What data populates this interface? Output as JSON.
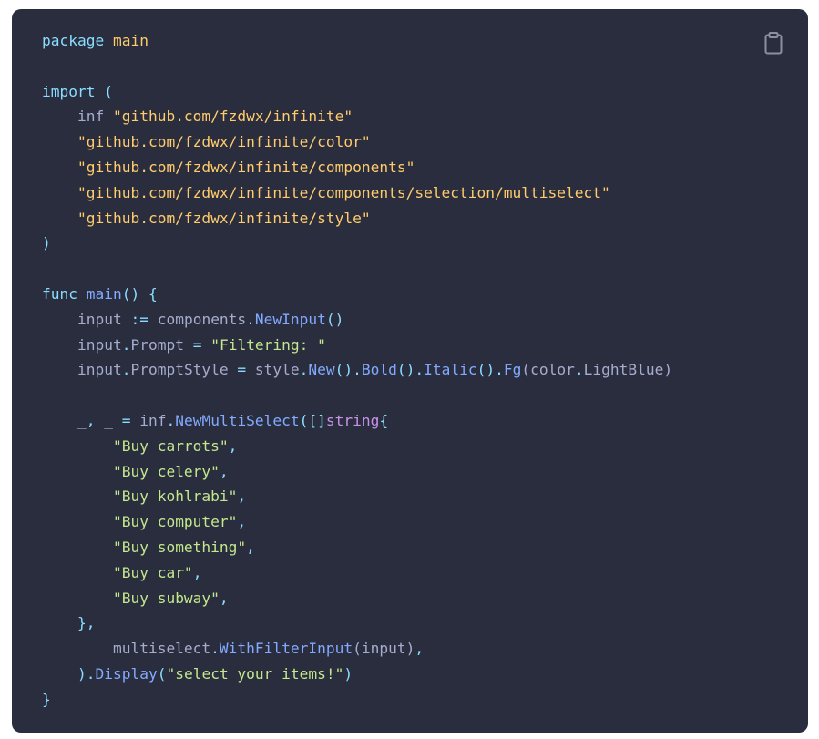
{
  "colors": {
    "background": "#2a2d3e",
    "keyword": "#89ddff",
    "string": "#ffcb6b",
    "string_alt": "#c3e88d",
    "function": "#82aaff",
    "identifier": "#a6accd",
    "type": "#c792ea"
  },
  "icons": {
    "copy": "clipboard-icon"
  },
  "code": {
    "l1": [
      "package",
      " ",
      "main"
    ],
    "l3": [
      "import",
      " ("
    ],
    "l4": [
      "    inf ",
      "\"github.com/fzdwx/infinite\""
    ],
    "l5": [
      "    ",
      "\"github.com/fzdwx/infinite/color\""
    ],
    "l6": [
      "    ",
      "\"github.com/fzdwx/infinite/components\""
    ],
    "l7": [
      "    ",
      "\"github.com/fzdwx/infinite/components/selection/multiselect\""
    ],
    "l8": [
      "    ",
      "\"github.com/fzdwx/infinite/style\""
    ],
    "l9": [
      ")"
    ],
    "l11": [
      "func",
      " ",
      "main",
      "() {"
    ],
    "l12": [
      "    input ",
      ":=",
      " components",
      ".",
      "NewInput",
      "()"
    ],
    "l13": [
      "    input",
      ".",
      "Prompt ",
      "=",
      " ",
      "\"Filtering: \""
    ],
    "l14": [
      "    input",
      ".",
      "PromptStyle ",
      "=",
      " style",
      ".",
      "New",
      "().",
      "Bold",
      "().",
      "Italic",
      "().",
      "Fg",
      "(color",
      ".",
      "LightBlue",
      ")"
    ],
    "l16": [
      "    _",
      ",",
      " _ ",
      "=",
      " inf",
      ".",
      "NewMultiSelect",
      "([]",
      "string",
      "{"
    ],
    "l17": [
      "        ",
      "\"Buy carrots\"",
      ","
    ],
    "l18": [
      "        ",
      "\"Buy celery\"",
      ","
    ],
    "l19": [
      "        ",
      "\"Buy kohlrabi\"",
      ","
    ],
    "l20": [
      "        ",
      "\"Buy computer\"",
      ","
    ],
    "l21": [
      "        ",
      "\"Buy something\"",
      ","
    ],
    "l22": [
      "        ",
      "\"Buy car\"",
      ","
    ],
    "l23": [
      "        ",
      "\"Buy subway\"",
      ","
    ],
    "l24": [
      "    ",
      "},"
    ],
    "l25": [
      "        multiselect",
      ".",
      "WithFilterInput",
      "(input)",
      ","
    ],
    "l26": [
      "    ",
      ").",
      "Display",
      "(",
      "\"select your items!\"",
      ")"
    ],
    "l27": [
      "}"
    ]
  }
}
